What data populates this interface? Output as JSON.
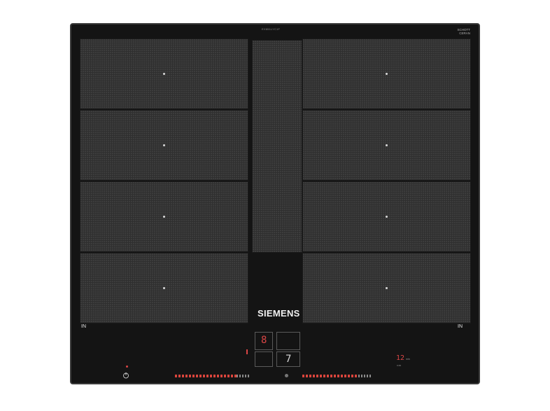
{
  "product": {
    "model": "EX651LYC1F",
    "brand": "SIEMENS",
    "glass_logo": {
      "line1": "SCHOTT",
      "line2": "CERAN",
      "line3": "CERAN"
    }
  },
  "cooking_zones": {
    "left": [
      "zone-left-1",
      "zone-left-2",
      "zone-left-3",
      "zone-left-4"
    ],
    "right": [
      "zone-right-1",
      "zone-right-2",
      "zone-right-3",
      "zone-right-4"
    ]
  },
  "labels": {
    "in_left": "IN",
    "in_right": "IN"
  },
  "controls": {
    "power_icon": "power-icon",
    "display_1": "8",
    "display_2": "7",
    "display_3": "8",
    "timer_value": "12",
    "timer_unit": "min",
    "timer_sub": "0-99"
  },
  "colors": {
    "glass": "#141414",
    "zone": "#2f2f2f",
    "indicator": "#d94545",
    "text": "#f2f2f2"
  }
}
